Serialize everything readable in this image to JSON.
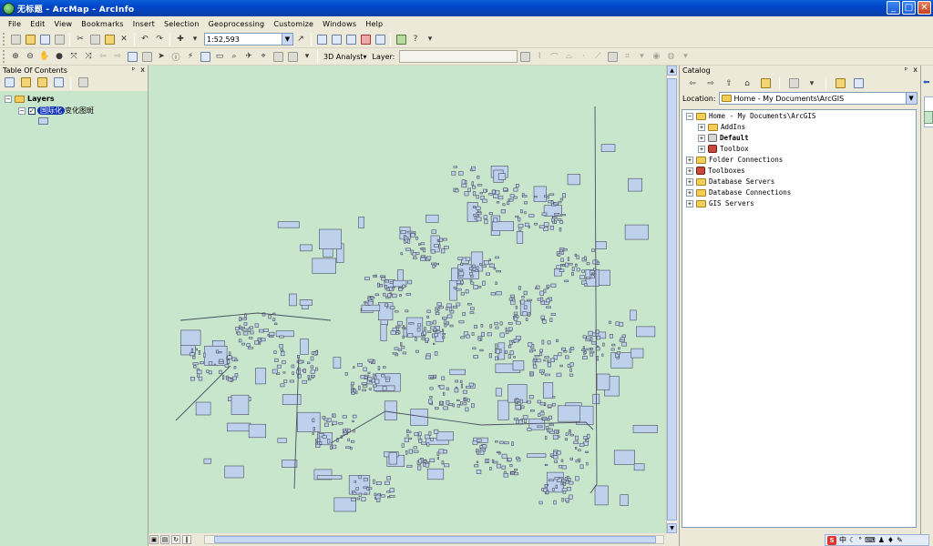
{
  "window": {
    "title": "无标题 - ArcMap - ArcInfo",
    "minimize": "_",
    "maximize": "□",
    "close": "✕"
  },
  "menu": [
    "File",
    "Edit",
    "View",
    "Bookmarks",
    "Insert",
    "Selection",
    "Geoprocessing",
    "Customize",
    "Windows",
    "Help"
  ],
  "toolbar": {
    "scale_value": "1:52,593",
    "analyst_label": "3D Analyst▾",
    "layer_label": "Layer:",
    "layer_value": ""
  },
  "toc": {
    "title": "Table Of Contents",
    "pin": "ᵖ",
    "close": "x",
    "layers_label": "Layers",
    "layer_name": "国际化变化图斑",
    "layer_name_hidden_part": "国际化"
  },
  "catalog": {
    "title": "Catalog",
    "pin": "ᵖ",
    "close": "x",
    "location_label": "Location:",
    "location_value": "Home - My Documents\\ArcGIS",
    "tree": [
      {
        "label": "Home - My Documents\\ArcGIS",
        "icon": "folder-icon"
      },
      {
        "label": "AddIns",
        "icon": "folder-icon"
      },
      {
        "label": "Default",
        "icon": "geodatabase-icon",
        "bold": true
      },
      {
        "label": "Toolbox",
        "icon": "toolbox-icon"
      },
      {
        "label": "Folder Connections",
        "icon": "folder-icon"
      },
      {
        "label": "Toolboxes",
        "icon": "toolbox-icon"
      },
      {
        "label": "Database Servers",
        "icon": "folder-icon"
      },
      {
        "label": "Database Connections",
        "icon": "folder-icon"
      },
      {
        "label": "GIS Servers",
        "icon": "folder-icon"
      }
    ]
  },
  "ime": {
    "brand": "S",
    "lang": "中"
  },
  "colors": {
    "map_background": "#c8e6cc",
    "parcel_fill": "#bdd0ec",
    "parcel_stroke": "#4a4f62",
    "title_bar": "#0a5fd8",
    "layer_highlight": "#0a2dba"
  }
}
